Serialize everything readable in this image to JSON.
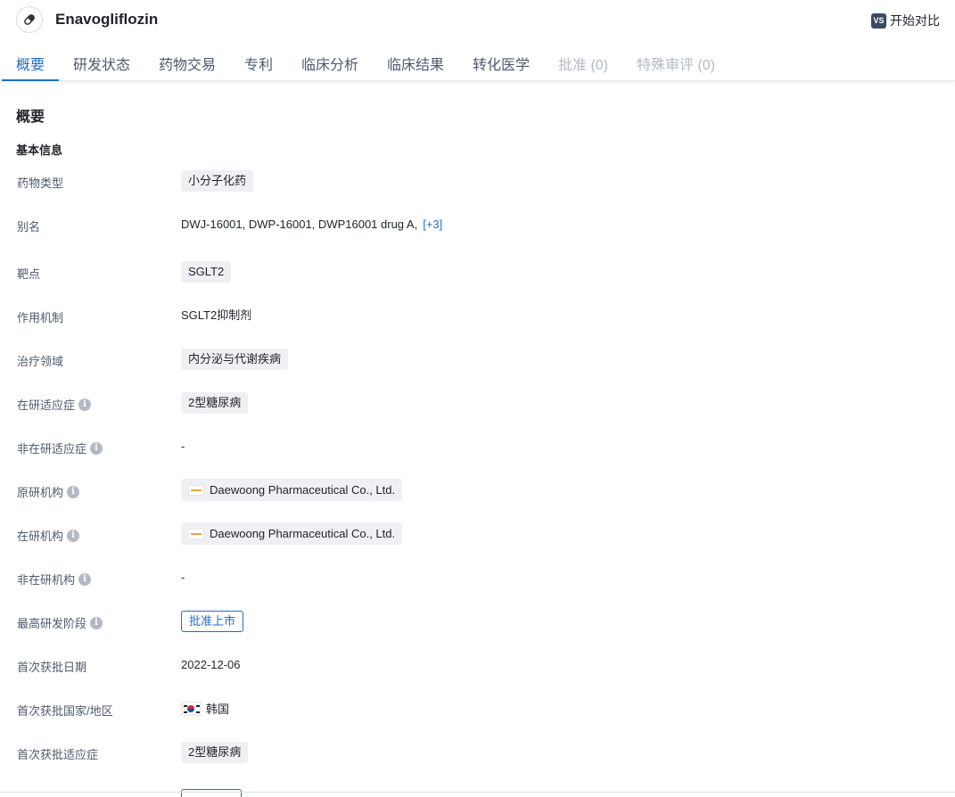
{
  "header": {
    "drug_name": "Enavogliflozin",
    "compare_badge": "VS",
    "compare_label": "开始对比"
  },
  "tabs": [
    {
      "label": "概要",
      "state": "active"
    },
    {
      "label": "研发状态",
      "state": "normal"
    },
    {
      "label": "药物交易",
      "state": "normal"
    },
    {
      "label": "专利",
      "state": "normal"
    },
    {
      "label": "临床分析",
      "state": "normal"
    },
    {
      "label": "临床结果",
      "state": "normal"
    },
    {
      "label": "转化医学",
      "state": "normal"
    },
    {
      "label": "批准 (0)",
      "state": "disabled"
    },
    {
      "label": "特殊审评 (0)",
      "state": "disabled"
    }
  ],
  "overview": {
    "section_title": "概要",
    "basic_info_title": "基本信息",
    "fields": {
      "drug_type": {
        "label": "药物类型",
        "value": "小分子化药"
      },
      "aliases": {
        "label": "别名",
        "values": [
          "DWJ-16001,",
          "DWP-16001,",
          "DWP16001 drug A,"
        ],
        "more": "[+3]"
      },
      "target": {
        "label": "靶点",
        "value": "SGLT2"
      },
      "mechanism": {
        "label": "作用机制",
        "value": "SGLT2抑制剂"
      },
      "therapeutic_area": {
        "label": "治疗领域",
        "value": "内分泌与代谢疾病"
      },
      "active_indication": {
        "label": "在研适应症",
        "value": "2型糖尿病"
      },
      "inactive_indication": {
        "label": "非在研适应症",
        "value": "-"
      },
      "originator": {
        "label": "原研机构",
        "value": "Daewoong Pharmaceutical Co., Ltd."
      },
      "active_org": {
        "label": "在研机构",
        "value": "Daewoong Pharmaceutical Co., Ltd."
      },
      "inactive_org": {
        "label": "非在研机构",
        "value": "-"
      },
      "highest_phase": {
        "label": "最高研发阶段",
        "value": "批准上市"
      },
      "first_approval_date": {
        "label": "首次获批日期",
        "value": "2022-12-06"
      },
      "first_approval_country": {
        "label": "首次获批国家/地区",
        "value": "韩国"
      },
      "first_approval_indication": {
        "label": "首次获批适应症",
        "value": "2型糖尿病"
      }
    },
    "info_icon": "i"
  },
  "colors": {
    "accent": "#1f6fc5",
    "tag_bg": "#eef0f3",
    "disabled": "#b3b9c2"
  }
}
